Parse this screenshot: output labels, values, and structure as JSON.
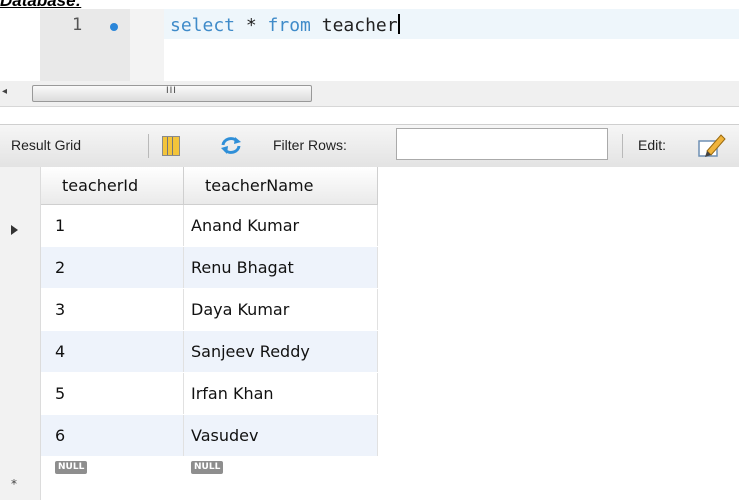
{
  "heading": "Database:",
  "editor": {
    "line_number": "1",
    "code_keyword_1": "select",
    "code_rest": " * ",
    "code_keyword_2": "from",
    "code_table": " teacher"
  },
  "toolbar": {
    "result_grid_label": "Result Grid",
    "filter_rows_label": "Filter Rows:",
    "filter_value": "",
    "edit_label": "Edit:"
  },
  "grid": {
    "columns": [
      "teacherId",
      "teacherName"
    ],
    "rows": [
      {
        "id": "1",
        "name": "Anand Kumar"
      },
      {
        "id": "2",
        "name": "Renu Bhagat"
      },
      {
        "id": "3",
        "name": "Daya Kumar"
      },
      {
        "id": "4",
        "name": "Sanjeev Reddy"
      },
      {
        "id": "5",
        "name": "Irfan Khan"
      },
      {
        "id": "6",
        "name": "Vasudev"
      }
    ],
    "null_label": "NULL"
  },
  "icons": {
    "grid_view": "grid-view-icon",
    "refresh": "refresh-icon",
    "edit": "edit-pencil-icon",
    "current_row": "current-row-arrow-icon",
    "new_row": "new-row-star-icon"
  }
}
